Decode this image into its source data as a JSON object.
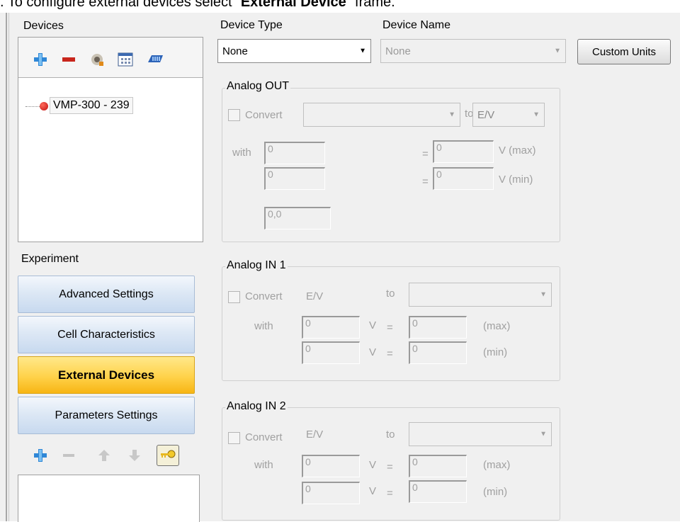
{
  "caption": {
    "prefix": ". To configure external devices select “",
    "bold": "External Device",
    "suffix": "” frame."
  },
  "devices": {
    "label": "Devices",
    "tree_item": "VMP-300 - 239",
    "toolbar": [
      "plus-icon",
      "minus-icon",
      "wrench-icon",
      "calendar-icon",
      "device-icon"
    ]
  },
  "experiment": {
    "label": "Experiment",
    "nav": [
      "Advanced Settings",
      "Cell Characteristics",
      "External Devices",
      "Parameters Settings"
    ],
    "active": "External Devices",
    "toolbar": [
      "plus-icon",
      "minus-icon",
      "arrow-up-icon",
      "arrow-down-icon",
      "key-icon"
    ]
  },
  "header": {
    "device_type_label": "Device Type",
    "device_type_value": "None",
    "device_name_label": "Device Name",
    "device_name_value": "None",
    "custom_units": "Custom Units"
  },
  "analog_out": {
    "title": "Analog OUT",
    "convert": "Convert",
    "to": "to",
    "unit": "E/V",
    "with": "with",
    "eq": "=",
    "v1": "0",
    "v2": "0",
    "v3": "0",
    "v4": "0",
    "v5": "0,0",
    "vmax": "V (max)",
    "vmin": "V (min)"
  },
  "analog_in1": {
    "title": "Analog IN 1",
    "convert": "Convert",
    "unit": "E/V",
    "to": "to",
    "with": "with",
    "v": "V",
    "eq": "=",
    "a": "0",
    "b": "0",
    "c": "0",
    "d": "0",
    "max": "(max)",
    "min": "(min)"
  },
  "analog_in2": {
    "title": "Analog IN 2",
    "convert": "Convert",
    "unit": "E/V",
    "to": "to",
    "with": "with",
    "v": "V",
    "eq": "=",
    "a": "0",
    "b": "0",
    "c": "0",
    "d": "0",
    "max": "(max)",
    "min": "(min)"
  },
  "colors": {
    "active_tab": "#ffd24a",
    "tab": "#dde8f5",
    "panel_bg": "#f0f0f0"
  }
}
